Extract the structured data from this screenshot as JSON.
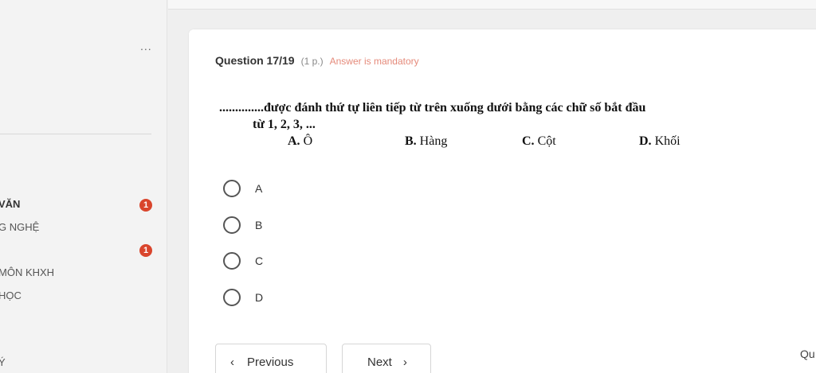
{
  "sidebar": {
    "more_label": "...",
    "items": [
      {
        "label": "VĂN",
        "badge": "1"
      },
      {
        "label": "G NGHỆ"
      },
      {
        "label": "",
        "badge": "1"
      },
      {
        "label": "MÔN KHXH"
      },
      {
        "label": "HỌC"
      },
      {
        "label": ""
      },
      {
        "label": "Ý"
      }
    ]
  },
  "question": {
    "title": "Question 17/19",
    "points": "(1 p.)",
    "mandatory": "Answer is mandatory",
    "text_line1": "..............được đánh thứ tự liên tiếp từ trên xuống dưới bằng các chữ số bắt đầu",
    "text_line2": "từ 1, 2, 3, ...",
    "choices": [
      {
        "letter": "A.",
        "text": "Ô"
      },
      {
        "letter": "B.",
        "text": "Hàng"
      },
      {
        "letter": "C.",
        "text": "Cột"
      },
      {
        "letter": "D.",
        "text": "Khối"
      }
    ]
  },
  "options": [
    "A",
    "B",
    "C",
    "D"
  ],
  "nav": {
    "prev_label": "Previous",
    "next_label": "Next",
    "prev_icon": "‹",
    "next_icon": "›",
    "partial_label": "Qu"
  },
  "colors": {
    "badge": "#d9452c",
    "mandatory": "#e58a7a"
  }
}
